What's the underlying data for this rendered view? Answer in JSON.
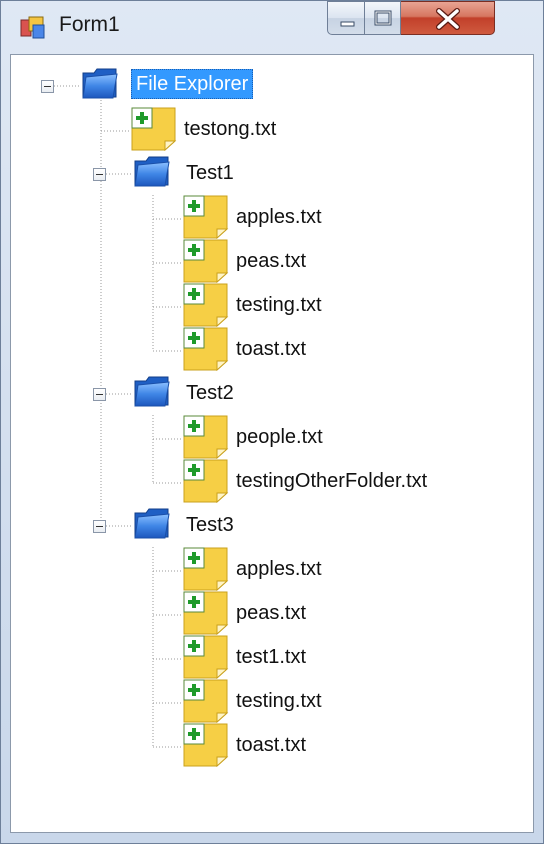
{
  "window": {
    "title": "Form1",
    "buttons": {
      "minimize": "minimize-icon",
      "maximize": "maximize-icon",
      "close": "close-icon"
    }
  },
  "tree": {
    "root": {
      "label": "File Explorer",
      "icon": "folder-icon",
      "expanded": true,
      "selected": true
    },
    "root_files": [
      {
        "label": "testong.txt",
        "icon": "file-icon"
      }
    ],
    "folders": [
      {
        "label": "Test1",
        "icon": "folder-icon",
        "expanded": true,
        "files": [
          {
            "label": "apples.txt"
          },
          {
            "label": "peas.txt"
          },
          {
            "label": "testing.txt"
          },
          {
            "label": "toast.txt"
          }
        ]
      },
      {
        "label": "Test2",
        "icon": "folder-icon",
        "expanded": true,
        "files": [
          {
            "label": "people.txt"
          },
          {
            "label": "testingOtherFolder.txt"
          }
        ]
      },
      {
        "label": "Test3",
        "icon": "folder-icon",
        "expanded": true,
        "files": [
          {
            "label": "apples.txt"
          },
          {
            "label": "peas.txt"
          },
          {
            "label": "test1.txt"
          },
          {
            "label": "testing.txt"
          },
          {
            "label": "toast.txt"
          }
        ]
      }
    ]
  },
  "colors": {
    "selection": "#3399ff",
    "tree_lines": "#999999",
    "file_yellow": "#f6cf45",
    "folder_blue": "#2f6fd0"
  }
}
